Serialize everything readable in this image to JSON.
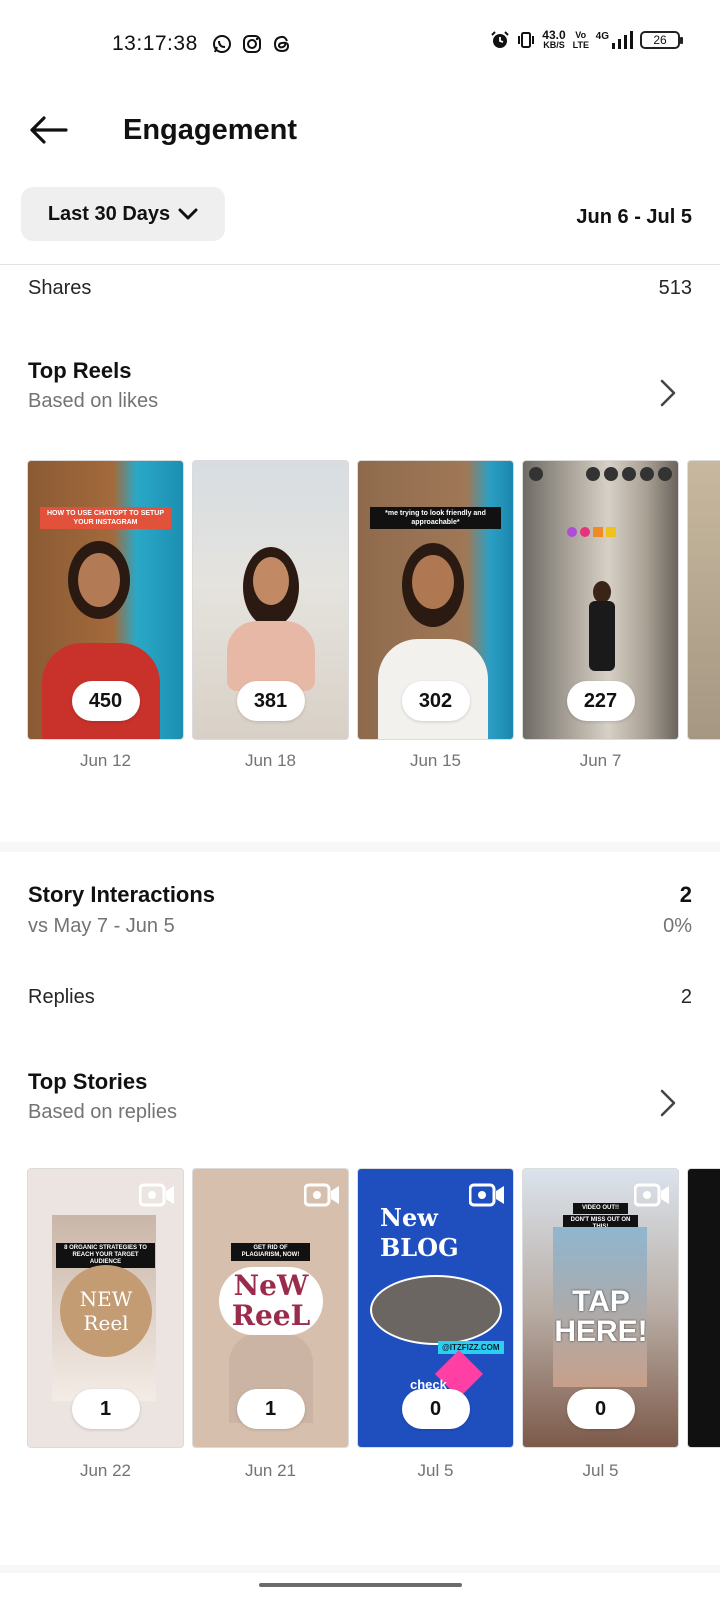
{
  "status_bar": {
    "time": "13:17:38",
    "net_speed": "43.0",
    "net_unit": "KB/S",
    "volte": "Vo LTE",
    "network": "4G",
    "battery": "26"
  },
  "header": {
    "title": "Engagement"
  },
  "filter": {
    "period_label": "Last 30 Days",
    "date_range": "Jun 6 - Jul 5"
  },
  "shares": {
    "label": "Shares",
    "value": "513"
  },
  "top_reels": {
    "title": "Top Reels",
    "subtitle": "Based on likes",
    "items": [
      {
        "count": "450",
        "date": "Jun 12",
        "caption": "HOW TO USE CHATGPT TO SETUP YOUR INSTAGRAM"
      },
      {
        "count": "381",
        "date": "Jun 18"
      },
      {
        "count": "302",
        "date": "Jun 15",
        "caption": "*me trying to look friendly and approachable*"
      },
      {
        "count": "227",
        "date": "Jun 7"
      }
    ]
  },
  "story_interactions": {
    "title": "Story Interactions",
    "value": "2",
    "comparison": "vs May 7 - Jun 5",
    "change": "0%"
  },
  "replies": {
    "label": "Replies",
    "value": "2"
  },
  "top_stories": {
    "title": "Top Stories",
    "subtitle": "Based on replies",
    "items": [
      {
        "count": "1",
        "date": "Jun 22",
        "caption": "8 ORGANIC STRATEGIES TO REACH YOUR TARGET AUDIENCE",
        "art": "NEW Reel"
      },
      {
        "count": "1",
        "date": "Jun 21",
        "caption": "GET RID OF PLAGIARISM, NOW!",
        "art": "NeW ReeL"
      },
      {
        "count": "0",
        "date": "Jul 5",
        "art": "New BLOG",
        "handle": "@ITZFIZZ.COM",
        "tag": "check"
      },
      {
        "count": "0",
        "date": "Jul 5",
        "caption": "VIDEO OUT!!",
        "caption2": "DON'T MISS OUT ON THIS!",
        "art": "TAP HERE!"
      }
    ]
  }
}
